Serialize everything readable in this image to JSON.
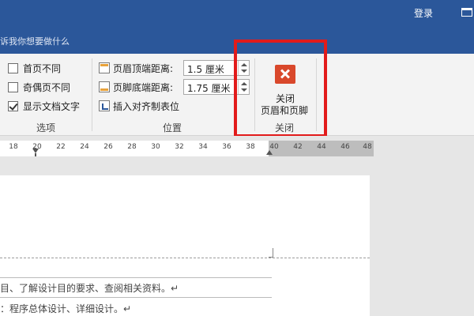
{
  "titlebar": {
    "login_label": "登录",
    "window_icon": "restore-icon"
  },
  "tellme": {
    "text": "诉我你想要做什么"
  },
  "ribbon": {
    "options_group": {
      "label": "选项",
      "items": [
        {
          "label": "首页不同",
          "checked": false
        },
        {
          "label": "奇偶页不同",
          "checked": false
        },
        {
          "label": "显示文档文字",
          "checked": true
        }
      ]
    },
    "position_group": {
      "label": "位置",
      "header_distance_label": "页眉顶端距离:",
      "header_distance_value": "1.5 厘米",
      "footer_distance_label": "页脚底端距离:",
      "footer_distance_value": "1.75 厘米",
      "insert_tab_label": "插入对齐制表位"
    },
    "close_group": {
      "label": "关闭",
      "button_line1": "关闭",
      "button_line2": "页眉和页脚"
    }
  },
  "ruler": {
    "ticks": [
      "18",
      "20",
      "22",
      "24",
      "26",
      "28",
      "30",
      "32",
      "34",
      "36",
      "38",
      "40",
      "42",
      "44",
      "46",
      "48"
    ]
  },
  "document": {
    "line1": "目、了解设计目的要求、查阅相关资料。↵",
    "line2": "：程序总体设计、详细设计。↵"
  },
  "colors": {
    "titlebar": "#2b579a",
    "highlight": "#e21b1b",
    "close_icon": "#d9482b"
  }
}
